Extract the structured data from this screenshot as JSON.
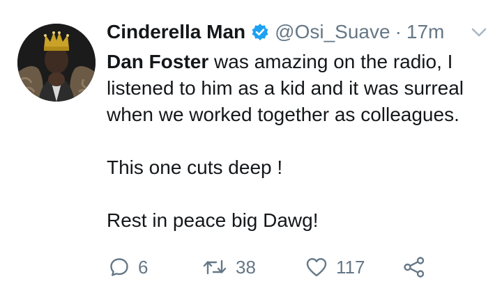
{
  "tweet": {
    "author": {
      "display_name": "Cinderella Man",
      "handle": "@Osi_Suave",
      "separator": "·",
      "timestamp": "17m",
      "verified": true
    },
    "body": {
      "mention": "Dan Foster",
      "line1_rest": " was amazing on the radio, I listened to him as a kid and it was surreal when we worked together as colleagues.",
      "paragraph2": "This one cuts deep !",
      "paragraph3": "Rest in peace big Dawg!"
    },
    "actions": {
      "reply_count": "6",
      "retweet_count": "38",
      "like_count": "117"
    },
    "icons": {
      "verified": "verified-badge-icon",
      "caret": "chevron-down-icon",
      "reply": "reply-icon",
      "retweet": "retweet-icon",
      "like": "heart-icon",
      "share": "share-icon"
    },
    "colors": {
      "text": "#14171a",
      "secondary": "#657786",
      "verified_blue": "#1da1f2",
      "caret": "#aab8c2"
    }
  }
}
